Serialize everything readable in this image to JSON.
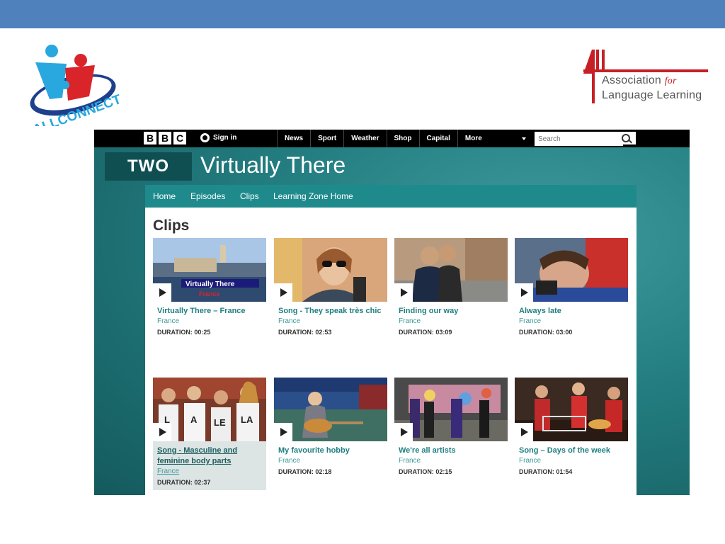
{
  "slide": {
    "topbar_color": "#4f81bd"
  },
  "logos": {
    "allconnect": {
      "text": "ALLCONNECT"
    },
    "all_association": {
      "mark": "ALL",
      "line1_a": "Association",
      "line1_b": "for",
      "line2": "Language Learning"
    }
  },
  "bbc": {
    "blocks": [
      "B",
      "B",
      "C"
    ],
    "signin": "Sign in",
    "nav": [
      "News",
      "Sport",
      "Weather",
      "Shop",
      "Capital",
      "More"
    ],
    "search_placeholder": "Search"
  },
  "programme": {
    "channel": "TWO",
    "title": "Virtually There"
  },
  "subnav": [
    "Home",
    "Episodes",
    "Clips",
    "Learning Zone Home"
  ],
  "page_title": "Clips",
  "clips": [
    {
      "title": "Virtually There – France",
      "subtitle": "France",
      "duration": "DURATION: 00:25",
      "thumb_text": "Virtually There",
      "thumb_text2": "France"
    },
    {
      "title": "Song - They speak très chic",
      "subtitle": "France",
      "duration": "DURATION: 02:53"
    },
    {
      "title": "Finding our way",
      "subtitle": "France",
      "duration": "DURATION: 03:09"
    },
    {
      "title": "Always late",
      "subtitle": "France",
      "duration": "DURATION: 03:00"
    },
    {
      "title": "Song - Masculine and feminine body parts",
      "subtitle": "France",
      "duration": "DURATION: 02:37",
      "thumb_letters": [
        "L",
        "A",
        "LE",
        "LA"
      ]
    },
    {
      "title": "My favourite hobby",
      "subtitle": "France",
      "duration": "DURATION: 02:18"
    },
    {
      "title": "We're all artists",
      "subtitle": "France",
      "duration": "DURATION: 02:15"
    },
    {
      "title": "Song – Days of the week",
      "subtitle": "France",
      "duration": "DURATION: 01:54"
    }
  ],
  "colors": {
    "teal_dark": "#145a5d",
    "teal": "#1f8a8c",
    "link": "#1f7f80",
    "all_red": "#c62026",
    "ac_blue": "#1e3f8c"
  }
}
